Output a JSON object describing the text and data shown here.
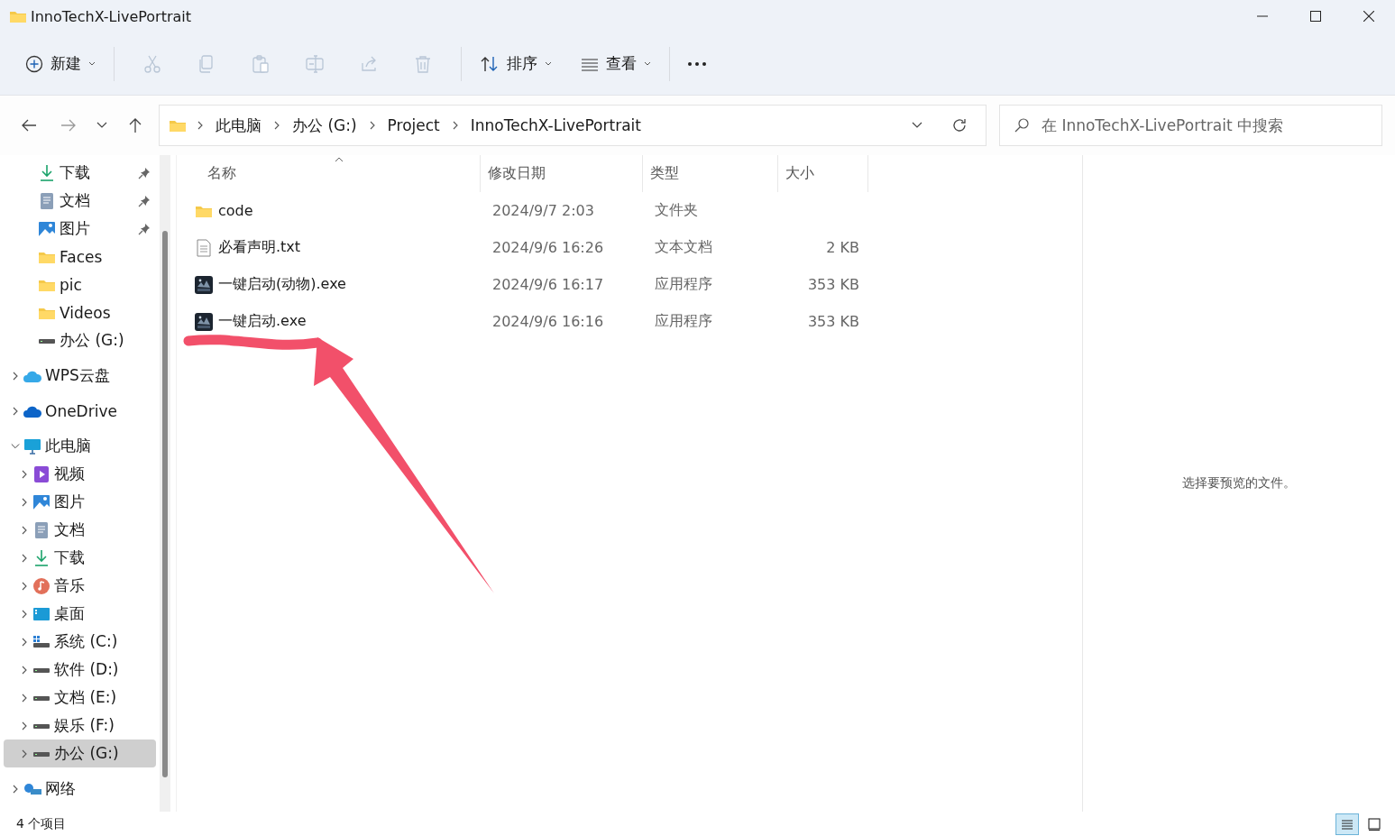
{
  "window": {
    "title": "InnoTechX-LivePortrait"
  },
  "toolbar": {
    "new_label": "新建",
    "actions": [
      {
        "kind": "cut",
        "disabled": true
      },
      {
        "kind": "copy",
        "disabled": true
      },
      {
        "kind": "paste",
        "disabled": true
      },
      {
        "kind": "rename",
        "disabled": true
      },
      {
        "kind": "share",
        "disabled": true
      },
      {
        "kind": "delete",
        "disabled": true
      }
    ],
    "sort_label": "排序",
    "view_label": "查看"
  },
  "address": {
    "crumbs": [
      "此电脑",
      "办公 (G:)",
      "Project",
      "InnoTechX-LivePortrait"
    ]
  },
  "search": {
    "placeholder": "在 InnoTechX-LivePortrait 中搜索"
  },
  "sidebar": {
    "quick_access": [
      {
        "label": "下载",
        "kind": "download",
        "pinned": true,
        "selected": false
      },
      {
        "label": "文档",
        "kind": "document",
        "pinned": true,
        "selected": false
      },
      {
        "label": "图片",
        "kind": "picture",
        "pinned": true,
        "selected": false
      },
      {
        "label": "Faces",
        "kind": "folder",
        "pinned": false,
        "selected": false
      },
      {
        "label": "pic",
        "kind": "folder",
        "pinned": false,
        "selected": false
      },
      {
        "label": "Videos",
        "kind": "folder",
        "pinned": false,
        "selected": false
      },
      {
        "label": "办公 (G:)",
        "kind": "drive",
        "pinned": false,
        "selected": false
      }
    ],
    "tree": [
      {
        "label": "WPS云盘",
        "kind": "wps-cloud",
        "expanded": false,
        "selected": false
      },
      {
        "label": "OneDrive",
        "kind": "onedrive",
        "expanded": false,
        "selected": false
      },
      {
        "label": "此电脑",
        "kind": "pc",
        "expanded": true,
        "selected": false,
        "children": [
          {
            "label": "视频",
            "kind": "video",
            "expanded": false,
            "selected": false
          },
          {
            "label": "图片",
            "kind": "picture",
            "expanded": false,
            "selected": false
          },
          {
            "label": "文档",
            "kind": "document",
            "expanded": false,
            "selected": false
          },
          {
            "label": "下载",
            "kind": "download",
            "expanded": false,
            "selected": false
          },
          {
            "label": "音乐",
            "kind": "music",
            "expanded": false,
            "selected": false
          },
          {
            "label": "桌面",
            "kind": "desktop",
            "expanded": false,
            "selected": false
          },
          {
            "label": "系统 (C:)",
            "kind": "system-drive",
            "expanded": false,
            "selected": false
          },
          {
            "label": "软件 (D:)",
            "kind": "drive",
            "expanded": false,
            "selected": false
          },
          {
            "label": "文档 (E:)",
            "kind": "drive",
            "expanded": false,
            "selected": false
          },
          {
            "label": "娱乐 (F:)",
            "kind": "drive",
            "expanded": false,
            "selected": false
          },
          {
            "label": "办公 (G:)",
            "kind": "drive",
            "expanded": false,
            "selected": true
          }
        ]
      },
      {
        "label": "网络",
        "kind": "network",
        "expanded": false,
        "selected": false
      }
    ]
  },
  "columns": [
    {
      "label": "名称",
      "sorted": true
    },
    {
      "label": "修改日期",
      "sorted": false
    },
    {
      "label": "类型",
      "sorted": false
    },
    {
      "label": "大小",
      "sorted": false
    }
  ],
  "files": [
    {
      "name": "code",
      "kind": "folder",
      "modified": "2024/9/7 2:03",
      "type": "文件夹",
      "selected": false
    },
    {
      "name": "必看声明.txt",
      "kind": "text",
      "modified": "2024/9/6 16:26",
      "type": "文本文档",
      "size": "2 KB",
      "selected": false
    },
    {
      "name": "一键启动(动物).exe",
      "kind": "app",
      "modified": "2024/9/6 16:17",
      "type": "应用程序",
      "size": "353 KB",
      "selected": false
    },
    {
      "name": "一键启动.exe",
      "kind": "app",
      "modified": "2024/9/6 16:16",
      "type": "应用程序",
      "size": "353 KB",
      "selected": false
    }
  ],
  "preview": {
    "message": "选择要预览的文件。"
  },
  "status_bar": {
    "count": "4 个项目",
    "views": [
      {
        "kind": "details",
        "selected": true
      },
      {
        "kind": "tiles",
        "selected": false
      }
    ]
  },
  "annotation": {
    "kind": "arrow",
    "color": "#f2506a"
  }
}
